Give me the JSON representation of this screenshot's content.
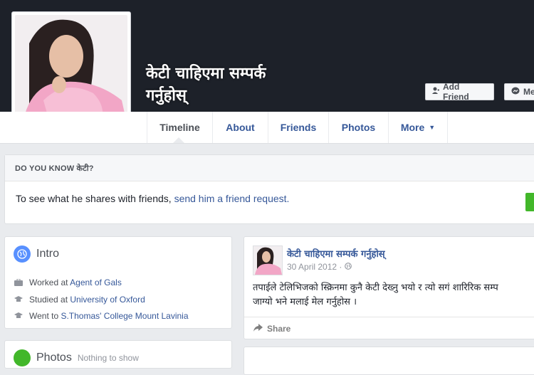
{
  "profile": {
    "name_line1": "केटी चाहिएमा सम्पर्क",
    "name_line2": "गर्नुहोस्"
  },
  "actions": {
    "add_friend": "Add Friend",
    "message": "Me"
  },
  "nav": {
    "tabs": [
      "Timeline",
      "About",
      "Friends",
      "Photos",
      "More"
    ]
  },
  "know_box": {
    "heading": "DO YOU KNOW केटी?",
    "text": "To see what he shares with friends, ",
    "link": "send him a friend request."
  },
  "intro": {
    "title": "Intro",
    "rows": [
      {
        "prefix": "Worked at ",
        "link": "Agent of Gals"
      },
      {
        "prefix": "Studied at ",
        "link": "University of Oxford"
      },
      {
        "prefix": "Went to ",
        "link": "S.Thomas' College Mount Lavinia"
      }
    ]
  },
  "photos": {
    "title": "Photos",
    "subtitle": "Nothing to show"
  },
  "post": {
    "author": "केटी चाहिएमा सम्पर्क गर्नुहोस्",
    "date": "30 April 2012 · ",
    "line1": "तपाईले टेलिभिजको स्क्रिनमा कुनै केटी देख्नु भयो र त्यो सगं शारिरिक सम्प",
    "line2": "जाग्यो भने मलाई मेल गर्नुहोस ।",
    "share": "Share"
  },
  "colors": {
    "cover": "#1d2129",
    "link": "#365899",
    "accent_green": "#42b72a"
  }
}
